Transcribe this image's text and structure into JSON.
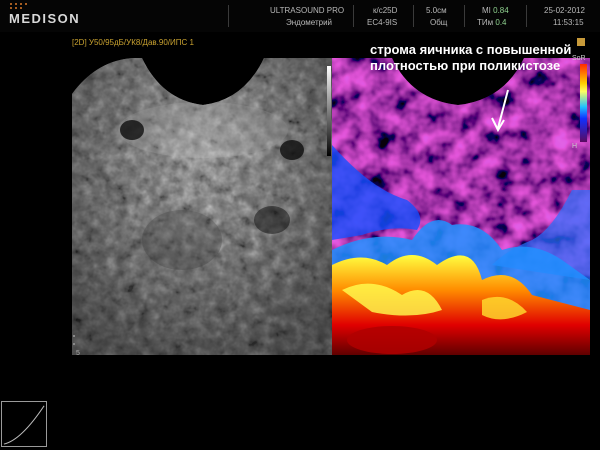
{
  "header": {
    "brand": "MEDISON",
    "system": "ULTRASOUND PRO",
    "preset": "Эндометрий",
    "probe_freq": "к/с25D",
    "probe": "EC4-9IS",
    "depth": "5.0см",
    "exam": "Общ",
    "mi_label": "MI",
    "mi_value": "0.84",
    "tim_label": "TИм",
    "tim_value": "0.4",
    "date": "25-02-2012",
    "time": "11:53:15"
  },
  "mode_line": "[2D] У50/95дБ/УК8/Дав.90/ИПС 1",
  "annotation": "строма яичника с повышенной плотностью при поликистозе",
  "scale": {
    "soft_label": "SoR",
    "hard_label": "H",
    "depth_label": "5"
  },
  "colors": {
    "accent": "#c9a230",
    "value_green": "#8fd18f",
    "logo_dots": "#d9792a"
  }
}
